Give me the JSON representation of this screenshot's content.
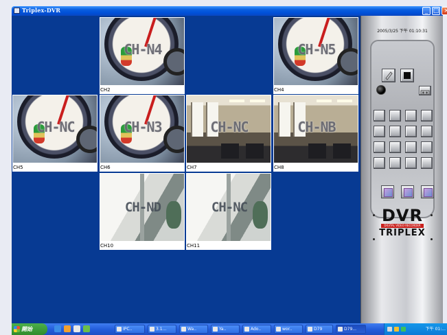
{
  "window": {
    "title": "Triplex-DVR",
    "min_glyph": "_",
    "max_glyph": "□",
    "close_glyph": "×"
  },
  "viewer": {
    "cameras": [
      {
        "label": "CH2",
        "overlay": "CH-N4",
        "kind": "gauge"
      },
      {
        "label": "CH4",
        "overlay": "CH-N5",
        "kind": "gauge"
      },
      {
        "label": "CH5",
        "overlay": "CH-NC",
        "kind": "gauge"
      },
      {
        "label": "CH6",
        "overlay": "CH-N3",
        "kind": "gauge"
      },
      {
        "label": "CH7",
        "overlay": "CH-NC",
        "kind": "office"
      },
      {
        "label": "CH8",
        "overlay": "CH-NB",
        "kind": "office"
      },
      {
        "label": "CH10",
        "overlay": "CH-ND",
        "kind": "bright"
      },
      {
        "label": "CH11",
        "overlay": "CH-NC",
        "kind": "bright"
      }
    ]
  },
  "panel": {
    "datetime": "2005/3/25 下午 01:10:31",
    "logo_main": "DVR",
    "logo_strip": "DIGITAL VIDEO RECORDER",
    "logo_sub": "TRIPLEX"
  },
  "taskbar": {
    "start_label": "開始",
    "tasks": [
      "IPC..",
      "3.1...",
      "Wa..",
      "Ya..",
      "Ado..",
      "wor..",
      "D79",
      "D79..."
    ],
    "clock": "下午 01:..."
  },
  "colors": {
    "viewer_bg": "#073a93",
    "title_blue": "#0050d8",
    "taskbar_blue": "#245edc"
  }
}
